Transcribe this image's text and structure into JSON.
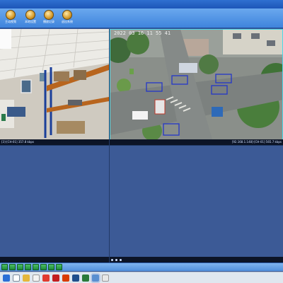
{
  "toolbar": {
    "buttons": [
      {
        "label": "主动视频",
        "icon": "camera-icon"
      },
      {
        "label": "本地设置",
        "icon": "gear-icon"
      },
      {
        "label": "播放记录",
        "icon": "playback-icon"
      },
      {
        "label": "退出系统",
        "icon": "power-icon"
      }
    ]
  },
  "panes": {
    "top_left": {
      "status_left": "[3]-[CH-01]  357.8 kbps"
    },
    "top_right": {
      "timestamp": "2022 03 16  11 55 41",
      "status_right": "[92.168.1.148]-[CH-01]  565.7 kbps"
    }
  },
  "colors": {
    "accent": "#4fd7e8",
    "toolbar": "#3f84dc",
    "empty_pane": "#3c5a96"
  }
}
